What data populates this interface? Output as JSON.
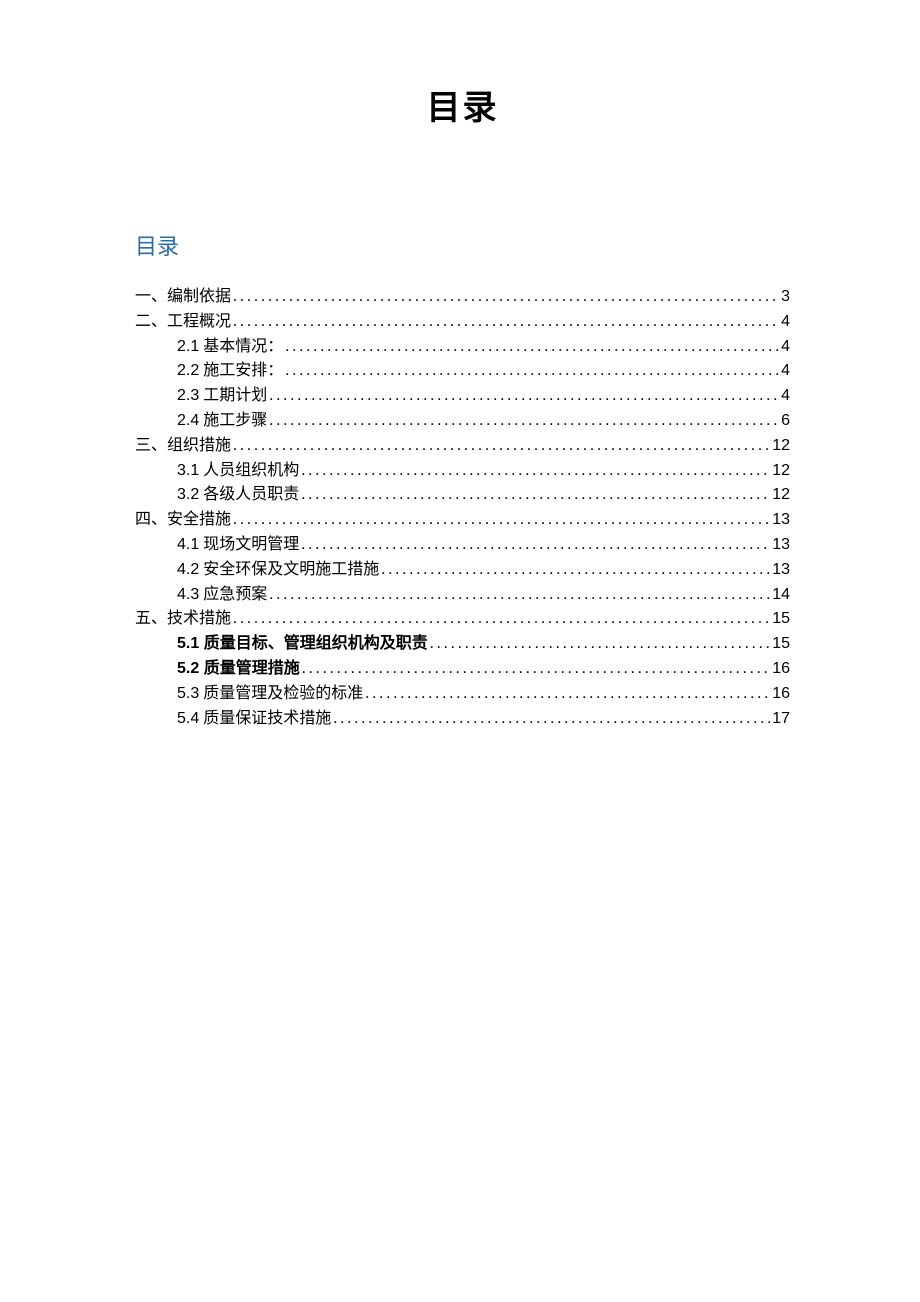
{
  "main_title": "目录",
  "section_title": "目录",
  "toc": [
    {
      "level": 1,
      "bold": false,
      "num": "",
      "label": "一、编制依据",
      "page": "3"
    },
    {
      "level": 1,
      "bold": false,
      "num": "",
      "label": "二、工程概况",
      "page": "4"
    },
    {
      "level": 2,
      "bold": false,
      "num": "2.1",
      "label": "  基本情况：",
      "page": "4"
    },
    {
      "level": 2,
      "bold": false,
      "num": "2.2",
      "label": "  施工安排：",
      "page": "4"
    },
    {
      "level": 2,
      "bold": false,
      "num": "2.3",
      "label": "  工期计划",
      "page": "4"
    },
    {
      "level": 2,
      "bold": false,
      "num": "2.4",
      "label": "  施工步骤",
      "page": "6"
    },
    {
      "level": 1,
      "bold": false,
      "num": "",
      "label": "三、组织措施",
      "page": "12"
    },
    {
      "level": 2,
      "bold": false,
      "num": "3.1",
      "label": "  人员组织机构",
      "page": "12"
    },
    {
      "level": 2,
      "bold": false,
      "num": "3.2",
      "label": "  各级人员职责",
      "page": "12"
    },
    {
      "level": 1,
      "bold": false,
      "num": "",
      "label": "四、安全措施",
      "page": "13"
    },
    {
      "level": 2,
      "bold": false,
      "num": "4.1",
      "label": "  现场文明管理",
      "page": "13"
    },
    {
      "level": 2,
      "bold": false,
      "num": "4.2",
      "label": " 安全环保及文明施工措施",
      "page": "13"
    },
    {
      "level": 2,
      "bold": false,
      "num": "4.3",
      "label": " 应急预案",
      "page": "14"
    },
    {
      "level": 1,
      "bold": false,
      "num": "",
      "label": "五、技术措施",
      "page": "15"
    },
    {
      "level": 2,
      "bold": true,
      "num": "5.1",
      "label": " 质量目标、管理组织机构及职责",
      "page": "15"
    },
    {
      "level": 2,
      "bold": true,
      "num": "5.2",
      "label": "  质量管理措施",
      "page": "16"
    },
    {
      "level": 2,
      "bold": false,
      "num": "5.3",
      "label": " 质量管理及检验的标准",
      "page": "16"
    },
    {
      "level": 2,
      "bold": false,
      "num": "5.4",
      "label": " 质量保证技术措施",
      "page": "17"
    }
  ]
}
